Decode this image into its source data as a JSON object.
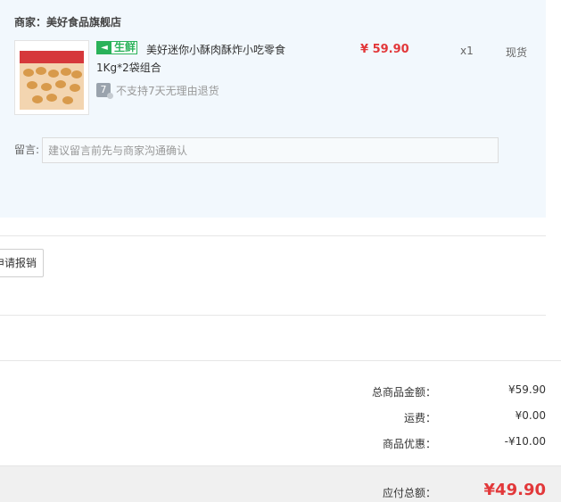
{
  "shop": {
    "label": "商家：美好食品旗舰店"
  },
  "item": {
    "tag": "生鲜",
    "title": "美好迷你小酥肉酥炸小吃零食",
    "sku": "1Kg*2袋组合",
    "no_return_icon": "7",
    "no_return_text": "不支持7天无理由退货",
    "price": "¥ 59.90",
    "quantity": "x1",
    "stock_status": "现货"
  },
  "memo": {
    "label": "留言:",
    "placeholder": "建议留言前先与商家沟通确认"
  },
  "reimburse": {
    "label": "申请报销"
  },
  "summary": {
    "goods_total_label": "总商品金额：",
    "goods_total_value": "¥59.90",
    "shipping_label": "运费：",
    "shipping_value": "¥0.00",
    "discount_label": "商品优惠：",
    "discount_value": "-¥10.00",
    "payable_label": "应付总额：",
    "payable_value": "¥49.90"
  },
  "colors": {
    "price_red": "#e2383a",
    "fresh_green": "#2ab25a",
    "panel_bg": "#f2f8fd"
  }
}
